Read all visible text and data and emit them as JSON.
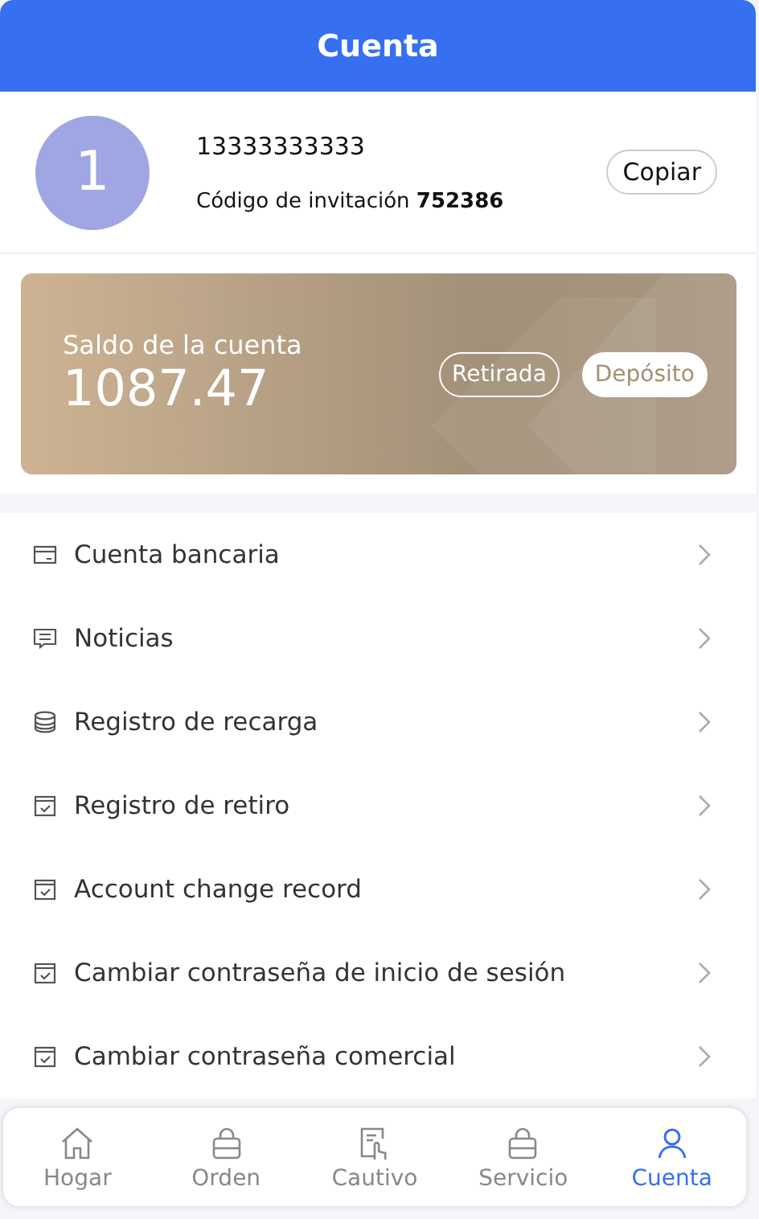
{
  "header": {
    "title": "Cuenta"
  },
  "profile": {
    "avatar": "1",
    "phone": "13333333333",
    "invite_label": "Código de invitación",
    "invite_code": "752386",
    "copy_button": "Copiar"
  },
  "balance": {
    "label": "Saldo de la cuenta",
    "amount": "1087.47",
    "withdraw_button": "Retirada",
    "deposit_button": "Depósito"
  },
  "menu": [
    {
      "label": "Cuenta bancaria",
      "kind": "card"
    },
    {
      "label": "Noticias",
      "kind": "message"
    },
    {
      "label": "Registro de recarga",
      "kind": "coins"
    },
    {
      "label": "Registro de retiro",
      "kind": "calendar"
    },
    {
      "label": "Account change record",
      "kind": "calendar"
    },
    {
      "label": "Cambiar contraseña de inicio de sesión",
      "kind": "calendar"
    },
    {
      "label": "Cambiar contraseña comercial",
      "kind": "calendar"
    }
  ],
  "tabs": [
    {
      "label": "Hogar",
      "kind": "home",
      "selected": false
    },
    {
      "label": "Orden",
      "kind": "bag",
      "selected": false
    },
    {
      "label": "Cautivo",
      "kind": "touch",
      "selected": false
    },
    {
      "label": "Servicio",
      "kind": "bag",
      "selected": false
    },
    {
      "label": "Cuenta",
      "kind": "user",
      "selected": true
    }
  ]
}
